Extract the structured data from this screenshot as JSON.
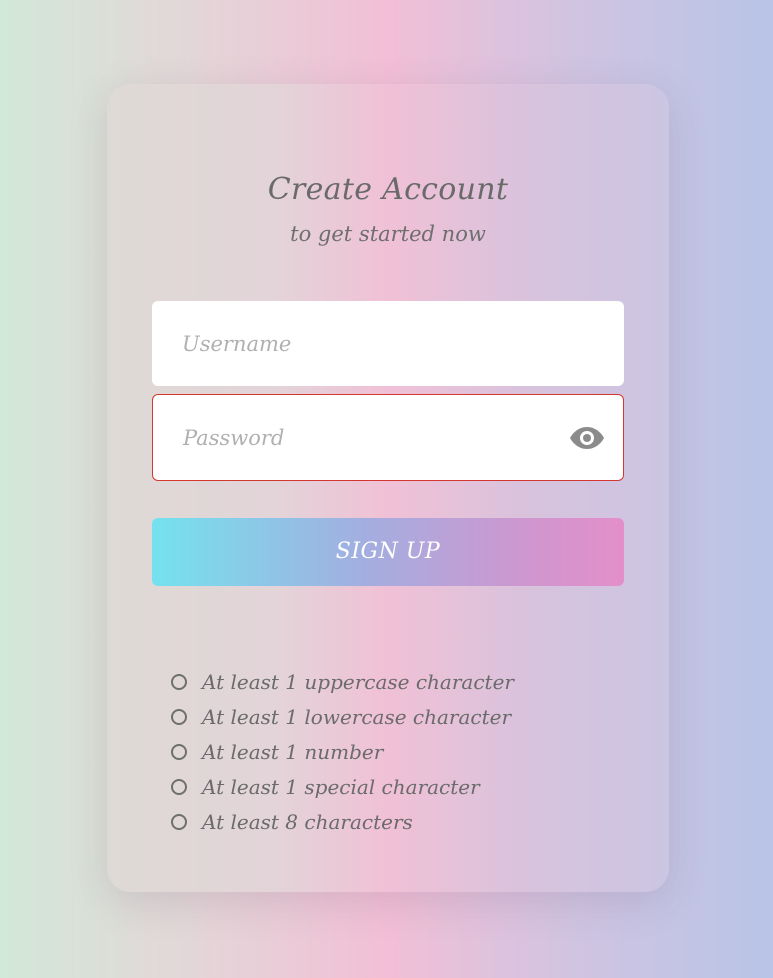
{
  "form": {
    "title": "Create Account",
    "subtitle": "to get started now",
    "username_placeholder": "Username",
    "password_placeholder": "Password",
    "submit_label": "SIGN UP"
  },
  "requirements": [
    {
      "label": "At least 1 uppercase character",
      "met": false
    },
    {
      "label": "At least 1 lowercase character",
      "met": false
    },
    {
      "label": "At least 1 number",
      "met": false
    },
    {
      "label": "At least 1 special character",
      "met": false
    },
    {
      "label": "At least 8 characters",
      "met": false
    }
  ],
  "icons": {
    "password_toggle": "eye-icon",
    "requirement_status": "circle-outline-icon"
  },
  "colors": {
    "password_border_error": "#d2382f",
    "button_gradient_start": "#74e2ee",
    "button_gradient_end": "#e38fc9",
    "text_primary": "#6a6a6a",
    "placeholder": "#b0b0b0"
  }
}
